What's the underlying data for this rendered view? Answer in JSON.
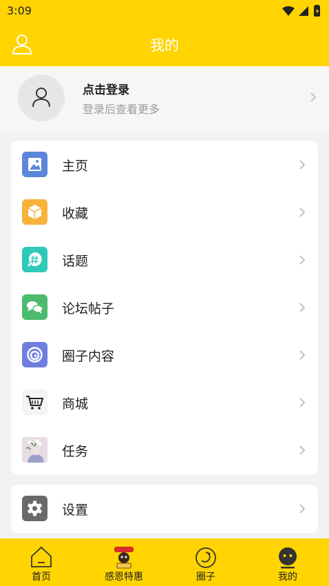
{
  "status": {
    "time": "3:09"
  },
  "header": {
    "title": "我的",
    "icon": "user-outline-icon"
  },
  "profile": {
    "title": "点击登录",
    "subtitle": "登录后查看更多",
    "icon": "avatar-icon"
  },
  "menu": [
    {
      "label": "主页",
      "icon": "image-icon",
      "color": "#5b86d9"
    },
    {
      "label": "收藏",
      "icon": "box-icon",
      "color": "#f7b23b"
    },
    {
      "label": "话题",
      "icon": "hashtag-chat-icon",
      "color": "#2ec9b8"
    },
    {
      "label": "论坛帖子",
      "icon": "chat-bubbles-icon",
      "color": "#4cbb6e"
    },
    {
      "label": "圈子内容",
      "icon": "spiral-icon",
      "color": "#6f7fe0"
    },
    {
      "label": "商城",
      "icon": "shopping-cart-icon",
      "color": "#f4f4f4"
    },
    {
      "label": "任务",
      "icon": "flower-photo-icon",
      "color": "#d8c8d4"
    }
  ],
  "settings": {
    "label": "设置",
    "icon": "gear-icon",
    "color": "#6a6a6a"
  },
  "tabs": [
    {
      "label": "首页",
      "icon": "home-icon"
    },
    {
      "label": "感恩特惠",
      "icon": "promo-mascot-icon"
    },
    {
      "label": "圈子",
      "icon": "circle-icon"
    },
    {
      "label": "我的",
      "icon": "profile-face-icon"
    }
  ]
}
